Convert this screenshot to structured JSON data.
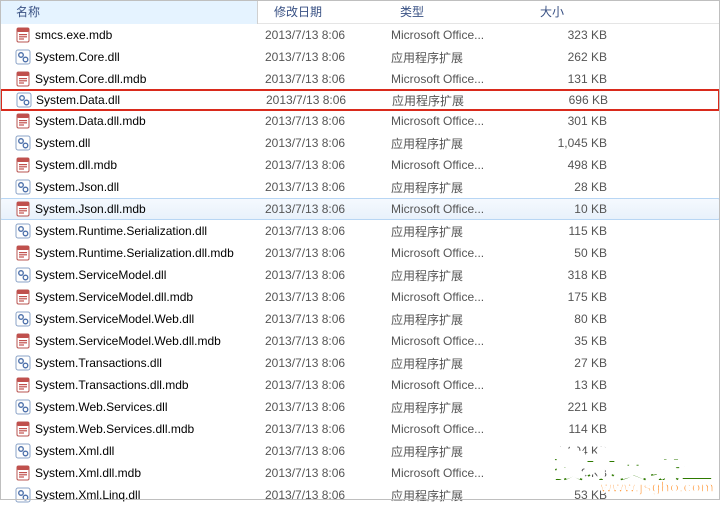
{
  "columns": {
    "name": "名称",
    "date": "修改日期",
    "type": "类型",
    "size": "大小"
  },
  "type_labels": {
    "mdb": "Microsoft Office...",
    "dll": "应用程序扩展"
  },
  "files": [
    {
      "name": "smcs.exe.mdb",
      "date": "2013/7/13 8:06",
      "tkey": "mdb",
      "size": "323 KB",
      "icon": "mdb"
    },
    {
      "name": "System.Core.dll",
      "date": "2013/7/13 8:06",
      "tkey": "dll",
      "size": "262 KB",
      "icon": "dll"
    },
    {
      "name": "System.Core.dll.mdb",
      "date": "2013/7/13 8:06",
      "tkey": "mdb",
      "size": "131 KB",
      "icon": "mdb"
    },
    {
      "name": "System.Data.dll",
      "date": "2013/7/13 8:06",
      "tkey": "dll",
      "size": "696 KB",
      "icon": "dll",
      "highlight": true
    },
    {
      "name": "System.Data.dll.mdb",
      "date": "2013/7/13 8:06",
      "tkey": "mdb",
      "size": "301 KB",
      "icon": "mdb"
    },
    {
      "name": "System.dll",
      "date": "2013/7/13 8:06",
      "tkey": "dll",
      "size": "1,045 KB",
      "icon": "dll"
    },
    {
      "name": "System.dll.mdb",
      "date": "2013/7/13 8:06",
      "tkey": "mdb",
      "size": "498 KB",
      "icon": "mdb"
    },
    {
      "name": "System.Json.dll",
      "date": "2013/7/13 8:06",
      "tkey": "dll",
      "size": "28 KB",
      "icon": "dll"
    },
    {
      "name": "System.Json.dll.mdb",
      "date": "2013/7/13 8:06",
      "tkey": "mdb",
      "size": "10 KB",
      "icon": "mdb",
      "selected": true
    },
    {
      "name": "System.Runtime.Serialization.dll",
      "date": "2013/7/13 8:06",
      "tkey": "dll",
      "size": "115 KB",
      "icon": "dll"
    },
    {
      "name": "System.Runtime.Serialization.dll.mdb",
      "date": "2013/7/13 8:06",
      "tkey": "mdb",
      "size": "50 KB",
      "icon": "mdb"
    },
    {
      "name": "System.ServiceModel.dll",
      "date": "2013/7/13 8:06",
      "tkey": "dll",
      "size": "318 KB",
      "icon": "dll"
    },
    {
      "name": "System.ServiceModel.dll.mdb",
      "date": "2013/7/13 8:06",
      "tkey": "mdb",
      "size": "175 KB",
      "icon": "mdb"
    },
    {
      "name": "System.ServiceModel.Web.dll",
      "date": "2013/7/13 8:06",
      "tkey": "dll",
      "size": "80 KB",
      "icon": "dll"
    },
    {
      "name": "System.ServiceModel.Web.dll.mdb",
      "date": "2013/7/13 8:06",
      "tkey": "mdb",
      "size": "35 KB",
      "icon": "mdb"
    },
    {
      "name": "System.Transactions.dll",
      "date": "2013/7/13 8:06",
      "tkey": "dll",
      "size": "27 KB",
      "icon": "dll"
    },
    {
      "name": "System.Transactions.dll.mdb",
      "date": "2013/7/13 8:06",
      "tkey": "mdb",
      "size": "13 KB",
      "icon": "mdb"
    },
    {
      "name": "System.Web.Services.dll",
      "date": "2013/7/13 8:06",
      "tkey": "dll",
      "size": "221 KB",
      "icon": "dll"
    },
    {
      "name": "System.Web.Services.dll.mdb",
      "date": "2013/7/13 8:06",
      "tkey": "mdb",
      "size": "114 KB",
      "icon": "mdb"
    },
    {
      "name": "System.Xml.dll",
      "date": "2013/7/13 8:06",
      "tkey": "dll",
      "size": "1,304 KB",
      "icon": "dll"
    },
    {
      "name": "System.Xml.dll.mdb",
      "date": "2013/7/13 8:06",
      "tkey": "mdb",
      "size": "599 KB",
      "icon": "mdb"
    },
    {
      "name": "System.Xml.Linq.dll",
      "date": "2013/7/13 8:06",
      "tkey": "dll",
      "size": "53 KB",
      "icon": "dll"
    }
  ],
  "watermark": {
    "text": "技术员联盟",
    "url": "www.jsgho.com"
  }
}
